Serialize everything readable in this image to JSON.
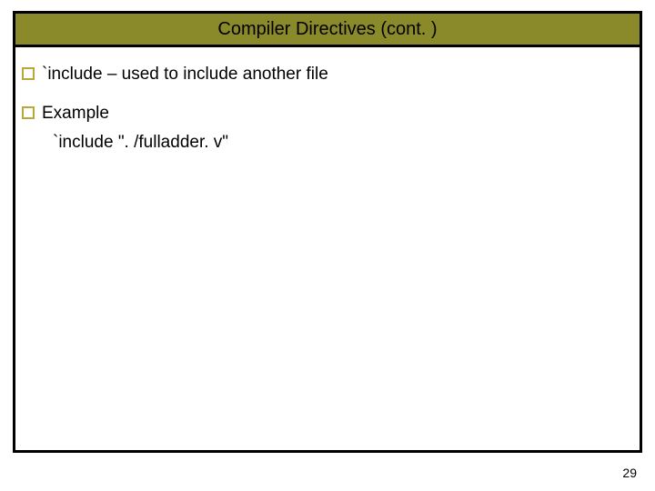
{
  "slide": {
    "title": "Compiler Directives (cont. )",
    "bullets": [
      {
        "text": "`include – used to include another file"
      },
      {
        "text": "Example"
      }
    ],
    "sub": "`include \". /fulladder. v\"",
    "page_number": "29"
  }
}
